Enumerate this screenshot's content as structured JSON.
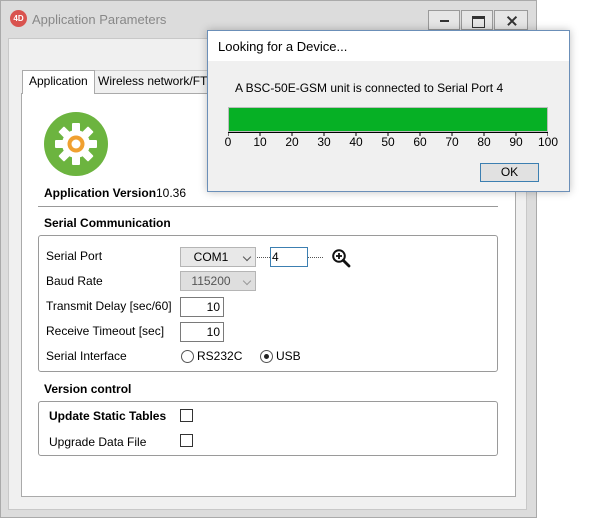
{
  "window": {
    "icon_text": "4D",
    "title": "Application Parameters"
  },
  "tabs": [
    "Application",
    "Wireless network/FTP"
  ],
  "app": {
    "version_label": "Application Version",
    "version_value": "10.36"
  },
  "serial": {
    "section_title": "Serial Communication",
    "port_label": "Serial Port",
    "port_value": "COM1",
    "port_number": "4",
    "baud_label": "Baud Rate",
    "baud_value": "115200",
    "transmit_label": "Transmit Delay  [sec/60]",
    "transmit_value": "10",
    "receive_label": "Receive Timeout [sec]",
    "receive_value": "10",
    "interface_label": "Serial Interface",
    "options": [
      "RS232C",
      "USB"
    ],
    "selected": "USB"
  },
  "version_control": {
    "section_title": "Version control",
    "update_label": "Update Static Tables",
    "update_checked": false,
    "upgrade_label": "Upgrade Data File",
    "upgrade_checked": false
  },
  "dialog": {
    "title": "Looking for a Device...",
    "message": "A BSC-50E-GSM unit is connected to Serial Port 4",
    "progress": 100,
    "ticks": [
      "0",
      "10",
      "20",
      "30",
      "40",
      "50",
      "60",
      "70",
      "80",
      "90",
      "100"
    ],
    "ok_label": "OK"
  },
  "colors": {
    "progress_fill": "#06b025",
    "gear": "#6cb43f",
    "app_icon": "#d9534f"
  }
}
